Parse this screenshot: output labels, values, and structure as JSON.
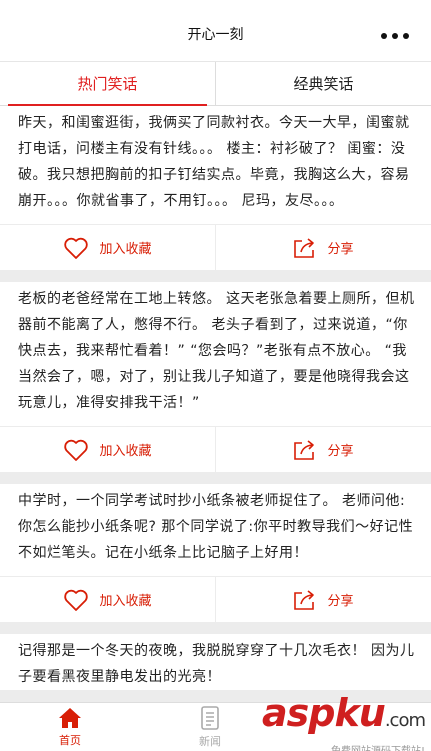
{
  "header": {
    "title": "开心一刻"
  },
  "tabs": [
    {
      "label": "热门笑话",
      "active": true
    },
    {
      "label": "经典笑话",
      "active": false
    }
  ],
  "jokes": [
    {
      "text": "昨天，和闺蜜逛街，我俩买了同款衬衣。今天一大早，闺蜜就打电话，问楼主有没有针线。。。 楼主：衬衫破了？ 闺蜜：没破。我只想把胸前的扣子钉结实点。毕竟，我胸这么大，容易崩开。。。你就省事了，不用钉。。。 尼玛，友尽。。。"
    },
    {
      "text": "老板的老爸经常在工地上转悠。 这天老张急着要上厕所，但机器前不能离了人，憋得不行。 老头子看到了，过来说道，“你快点去，我来帮忙看着！” “您会吗？”老张有点不放心。 “我当然会了，嗯，对了，别让我儿子知道了，要是他晓得我会这玩意儿，准得安排我干活！”"
    },
    {
      "text": "中学时，一个同学考试时抄小纸条被老师捉住了。 老师问他:你怎么能抄小纸条呢? 那个同学说了:你平时教导我们～好记性不如烂笔头。记在小纸条上比记脑子上好用！"
    },
    {
      "text": "记得那是一个冬天的夜晚，我脱脱穿穿了十几次毛衣！ 因为儿子要看黑夜里静电发出的光亮！"
    }
  ],
  "actions": {
    "favorite_label": "加入收藏",
    "share_label": "分享"
  },
  "bottom_tabs": [
    {
      "label": "首页",
      "icon": "home-icon",
      "active": true
    },
    {
      "label": "新闻",
      "icon": "news-icon",
      "active": false
    }
  ],
  "watermark": {
    "logo_main": "asp",
    "logo_ku": "ku",
    "logo_tld": ".com",
    "subtitle": "免费网站源码下载站!"
  },
  "colors": {
    "accent": "#d81e06",
    "active_tab": "#e02020",
    "green_bar": "#2fbf2f"
  }
}
